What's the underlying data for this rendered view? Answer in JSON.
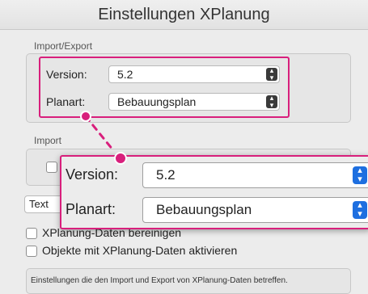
{
  "window": {
    "title": "Einstellungen XPlanung"
  },
  "import_export": {
    "label": "Import/Export",
    "version_label": "Version:",
    "version_value": "5.2",
    "planart_label": "Planart:",
    "planart_value": "Bebauungsplan"
  },
  "import": {
    "label": "Import",
    "text_field_partial": "Text"
  },
  "options": [
    {
      "label": "XPlanung-Daten bereinigen",
      "checked": false
    },
    {
      "label": "Objekte mit XPlanung-Daten aktivieren",
      "checked": false
    }
  ],
  "callout": {
    "version_label": "Version:",
    "version_value": "5.2",
    "planart_label": "Planart:",
    "planart_value": "Bebauungsplan"
  },
  "footer": {
    "text": "Einstellungen die den Import und Export von XPlanung-Daten betreffen."
  },
  "colors": {
    "highlight": "#d81f7c",
    "stepper_active": "#1e6fe0"
  },
  "icons": {
    "stepper": "up-down-chevrons-icon",
    "pointer": "callout-dot-icon"
  }
}
